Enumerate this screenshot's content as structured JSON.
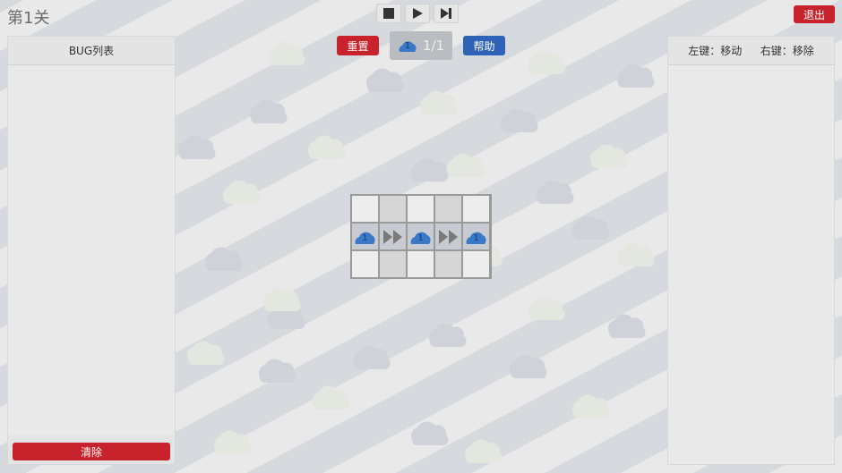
{
  "header": {
    "level_title": "第1关",
    "exit_label": "退出",
    "controls": [
      {
        "name": "stop-button",
        "icon": "stop-icon"
      },
      {
        "name": "play-button",
        "icon": "play-icon"
      },
      {
        "name": "step-button",
        "icon": "step-forward-icon"
      }
    ]
  },
  "left_panel": {
    "title": "BUG列表",
    "clear_label": "清除"
  },
  "right_panel": {
    "left_hint": "左键：移动",
    "right_hint": "右键：移除"
  },
  "actions": {
    "reset_label": "重置",
    "help_label": "帮助",
    "counter_icon_number": "1",
    "counter_text": "1/1"
  },
  "board": {
    "rows": 3,
    "cols": 5,
    "cells": [
      [
        {
          "type": "empty"
        },
        {
          "type": "empty"
        },
        {
          "type": "empty"
        },
        {
          "type": "empty"
        },
        {
          "type": "empty"
        }
      ],
      [
        {
          "type": "cloud",
          "number": "1"
        },
        {
          "type": "arrow"
        },
        {
          "type": "cloud",
          "number": "1"
        },
        {
          "type": "arrow"
        },
        {
          "type": "cloud",
          "number": "1"
        }
      ],
      [
        {
          "type": "empty"
        },
        {
          "type": "empty"
        },
        {
          "type": "empty"
        },
        {
          "type": "empty"
        },
        {
          "type": "empty"
        }
      ]
    ]
  },
  "colors": {
    "red": "#c8232c",
    "blue": "#2e63b8",
    "cloud_blue": "#3a78c8"
  }
}
